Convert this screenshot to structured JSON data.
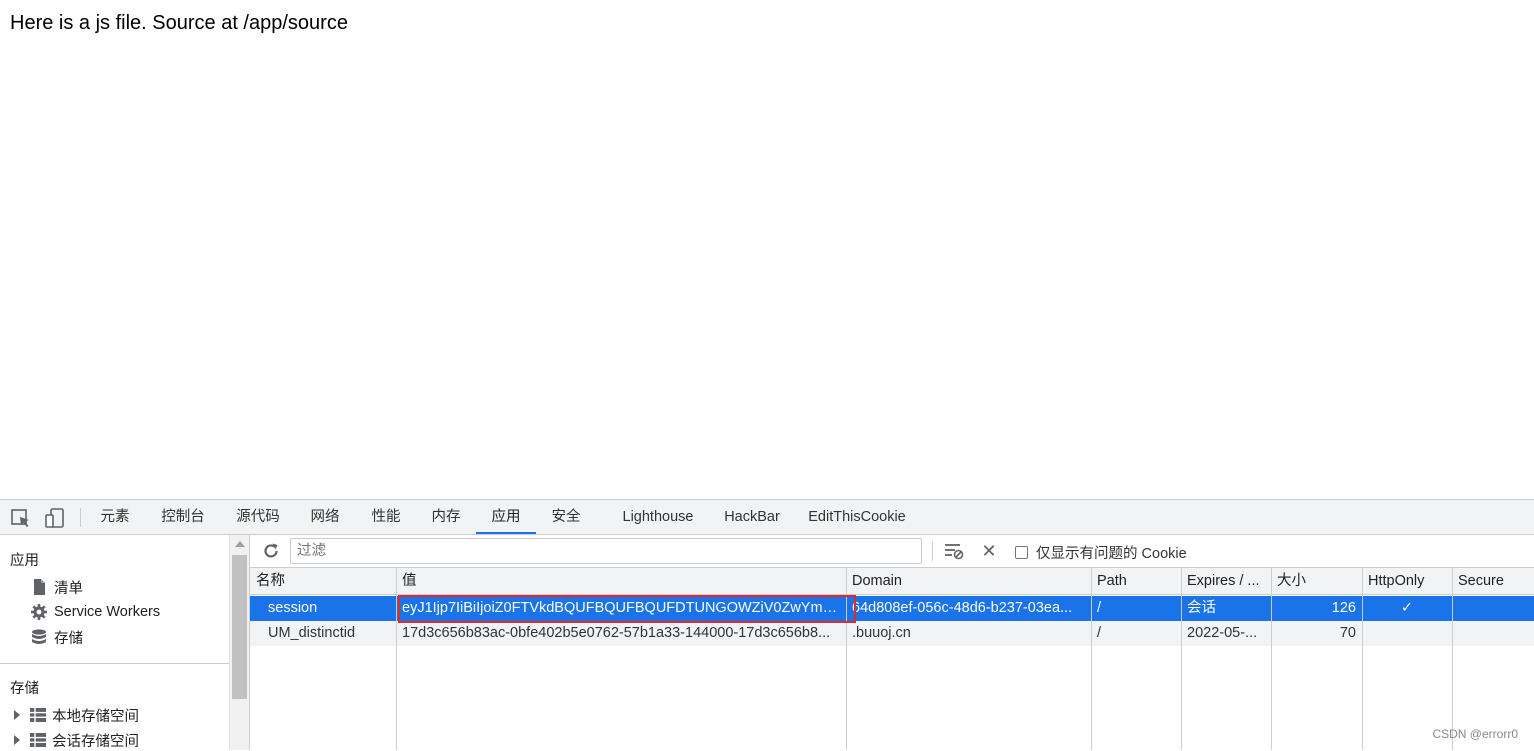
{
  "page": {
    "text": "Here is a js file. Source at /app/source"
  },
  "devtools": {
    "tabs": [
      {
        "label": "元素"
      },
      {
        "label": "控制台"
      },
      {
        "label": "源代码"
      },
      {
        "label": "网络"
      },
      {
        "label": "性能"
      },
      {
        "label": "内存"
      },
      {
        "label": "应用",
        "active": true
      },
      {
        "label": "安全"
      },
      {
        "label": "Lighthouse"
      },
      {
        "label": "HackBar"
      },
      {
        "label": "EditThisCookie"
      }
    ],
    "sidebar": {
      "app_heading": "应用",
      "app_items": [
        {
          "label": "清单",
          "icon": "file-icon"
        },
        {
          "label": "Service Workers",
          "icon": "gear-icon"
        },
        {
          "label": "存储",
          "icon": "database-icon"
        }
      ],
      "storage_heading": "存储",
      "storage_items": [
        {
          "label": "本地存储空间",
          "icon": "grid-icon"
        },
        {
          "label": "会话存储空间",
          "icon": "grid-icon"
        }
      ]
    },
    "toolbar": {
      "filter_placeholder": "过滤",
      "only_issues_label": "仅显示有问题的 Cookie"
    },
    "cookies": {
      "columns": [
        "名称",
        "值",
        "Domain",
        "Path",
        "Expires / ...",
        "大小",
        "HttpOnly",
        "Secure"
      ],
      "rows": [
        {
          "name": "session",
          "value": "eyJ1Ijp7IiBiIjoiZ0FTVkdBQUFBQUFBQUFDTUNGOWZiV0ZwYmw5...",
          "domain": "64d808ef-056c-48d6-b237-03ea...",
          "path": "/",
          "expires": "会话",
          "size": "126",
          "httponly": "✓",
          "secure": "",
          "selected": true
        },
        {
          "name": "UM_distinctid",
          "value": "17d3c656b83ac-0bfe402b5e0762-57b1a33-144000-17d3c656b8...",
          "domain": ".buuoj.cn",
          "path": "/",
          "expires": "2022-05-...",
          "size": "70",
          "httponly": "",
          "secure": "",
          "selected": false
        }
      ]
    }
  },
  "watermark": "CSDN @errorr0",
  "colors": {
    "accent": "#1a73e8",
    "highlight": "#e02b2b"
  }
}
